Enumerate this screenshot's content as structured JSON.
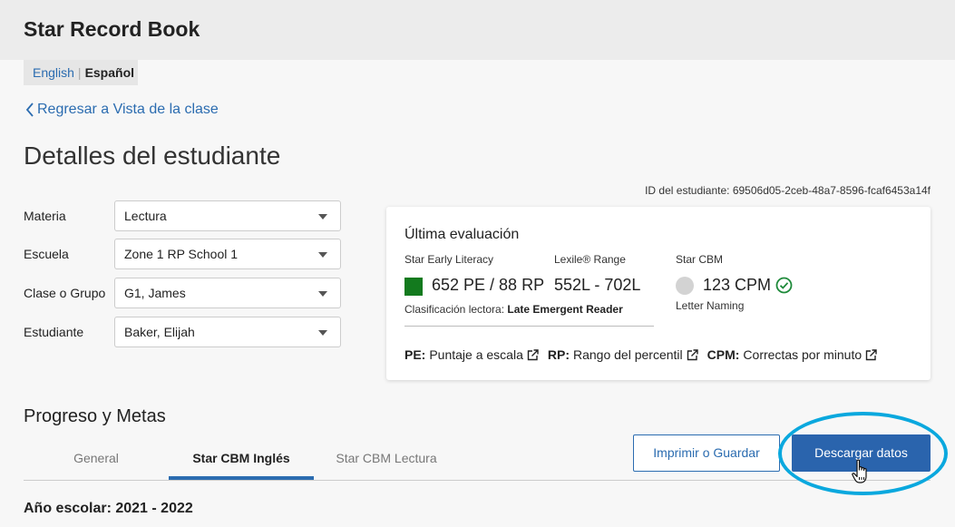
{
  "app": {
    "title": "Star Record Book"
  },
  "language": {
    "english": "English",
    "separator": "|",
    "spanish": "Español"
  },
  "nav": {
    "back_label": "Regresar a Vista de la clase"
  },
  "page": {
    "title": "Detalles del estudiante"
  },
  "student_id": "ID del estudiante: 69506d05-2ceb-48a7-8596-fcaf6453a14f",
  "filters": [
    {
      "label": "Materia",
      "value": "Lectura"
    },
    {
      "label": "Escuela",
      "value": "Zone 1 RP School 1"
    },
    {
      "label": "Clase o Grupo",
      "value": "G1, James"
    },
    {
      "label": "Estudiante",
      "value": "Baker, Elijah"
    }
  ],
  "last_assessment": {
    "title": "Última evaluación",
    "early_literacy": {
      "label": "Star Early Literacy",
      "value": "652 PE / 88 RP",
      "color": "#137a1e"
    },
    "lexile": {
      "label": "Lexile® Range",
      "value": "552L - 702L"
    },
    "cbm": {
      "label": "Star CBM",
      "value": "123 CPM",
      "sub_label": "Letter Naming"
    },
    "classification_label": "Clasificación lectora:",
    "classification_value": "Late Emergent Reader",
    "legend": [
      {
        "abbr": "PE:",
        "text": "Puntaje a escala"
      },
      {
        "abbr": "RP:",
        "text": "Rango del percentil"
      },
      {
        "abbr": "CPM:",
        "text": "Correctas por minuto"
      }
    ]
  },
  "progress": {
    "title": "Progreso y Metas",
    "tabs": [
      "General",
      "Star CBM  Inglés",
      "Star CBM Lectura"
    ],
    "active_tab": 1,
    "print_button": "Imprimir o Guardar",
    "download_button": "Descargar datos",
    "school_year": "Año escolar: 2021 - 2022"
  },
  "colors": {
    "accent": "#2b6cb0",
    "primary_button": "#2a64ad",
    "highlight": "#0aa8de",
    "success": "#1e8a3a"
  }
}
